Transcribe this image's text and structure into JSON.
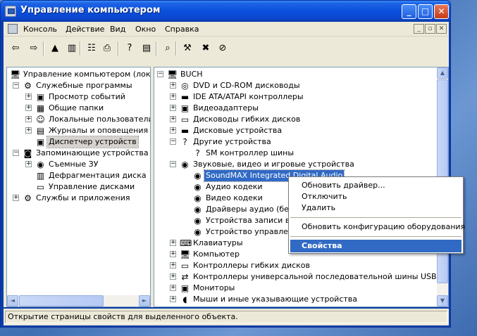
{
  "window": {
    "title": "Управление компьютером",
    "minimize_glyph": "_",
    "maximize_glyph": "□",
    "close_glyph": "✕"
  },
  "menubar": {
    "items": [
      "Консоль",
      "Действие",
      "Вид",
      "Окно",
      "Справка"
    ],
    "mdi_minimize": "_",
    "mdi_restore": "▫",
    "mdi_close": "✕"
  },
  "toolbar": {
    "tools": [
      {
        "icon": "back-arrow-icon",
        "glyph": "⇦"
      },
      {
        "icon": "forward-arrow-icon",
        "glyph": "⇨"
      },
      {
        "icon": "up-folder-icon",
        "glyph": "▲"
      },
      {
        "icon": "show-hide-tree-icon",
        "glyph": "▥"
      },
      {
        "icon": "properties-icon",
        "glyph": "☷"
      },
      {
        "icon": "print-icon",
        "glyph": "⎙"
      },
      {
        "icon": "help-icon",
        "glyph": "?"
      },
      {
        "icon": "show-hide-action-pane-icon",
        "glyph": "▤"
      },
      {
        "icon": "scan-hardware-icon",
        "glyph": "⌕"
      },
      {
        "icon": "update-driver-icon",
        "glyph": "⚒"
      },
      {
        "icon": "uninstall-device-icon",
        "glyph": "✖"
      },
      {
        "icon": "disable-device-icon",
        "glyph": "⊘"
      }
    ]
  },
  "left_tree": {
    "items": [
      {
        "label": "Управление компьютером (локаль",
        "icon": "computer-management-icon",
        "glyph": "🖥",
        "expander": "",
        "level": 0
      },
      {
        "label": "Служебные программы",
        "icon": "system-tools-icon",
        "glyph": "⚙",
        "expander": "−",
        "level": 1
      },
      {
        "label": "Просмотр событий",
        "icon": "event-viewer-icon",
        "glyph": "▣",
        "expander": "+",
        "level": 2
      },
      {
        "label": "Общие папки",
        "icon": "shared-folders-icon",
        "glyph": "▦",
        "expander": "+",
        "level": 2
      },
      {
        "label": "Локальные пользователи",
        "icon": "local-users-icon",
        "glyph": "☺",
        "expander": "+",
        "level": 2
      },
      {
        "label": "Журналы и оповещения пр",
        "icon": "performance-logs-icon",
        "glyph": "▤",
        "expander": "+",
        "level": 2
      },
      {
        "label": "Диспетчер устройств",
        "icon": "device-manager-icon",
        "glyph": "▣",
        "expander": "",
        "level": 2,
        "selected": true
      },
      {
        "label": "Запоминающие устройства",
        "icon": "storage-icon",
        "glyph": "◙",
        "expander": "−",
        "level": 1
      },
      {
        "label": "Съемные ЗУ",
        "icon": "removable-storage-icon",
        "glyph": "◉",
        "expander": "+",
        "level": 2
      },
      {
        "label": "Дефрагментация диска",
        "icon": "defragmenter-icon",
        "glyph": "▥",
        "expander": "",
        "level": 2
      },
      {
        "label": "Управление дисками",
        "icon": "disk-management-icon",
        "glyph": "▭",
        "expander": "",
        "level": 2
      },
      {
        "label": "Службы и приложения",
        "icon": "services-apps-icon",
        "glyph": "⚙",
        "expander": "+",
        "level": 1
      }
    ]
  },
  "right_tree": {
    "items": [
      {
        "label": "BUCH",
        "icon": "computer-icon",
        "glyph": "🖥",
        "expander": "−",
        "level": 0
      },
      {
        "label": "DVD и CD-ROM дисководы",
        "icon": "cdrom-icon",
        "glyph": "◎",
        "expander": "+",
        "level": 1
      },
      {
        "label": "IDE ATA/ATAPI контроллеры",
        "icon": "ide-controller-icon",
        "glyph": "▬",
        "expander": "+",
        "level": 1
      },
      {
        "label": "Видеоадаптеры",
        "icon": "display-adapter-icon",
        "glyph": "▣",
        "expander": "+",
        "level": 1
      },
      {
        "label": "Дисководы гибких дисков",
        "icon": "floppy-drive-icon",
        "glyph": "▭",
        "expander": "+",
        "level": 1
      },
      {
        "label": "Дисковые устройства",
        "icon": "disk-drive-icon",
        "glyph": "▬",
        "expander": "+",
        "level": 1
      },
      {
        "label": "Другие устройства",
        "icon": "unknown-device-icon",
        "glyph": "?",
        "expander": "−",
        "level": 1
      },
      {
        "label": "SM контроллер шины",
        "icon": "unknown-device-icon",
        "glyph": "?",
        "expander": "",
        "level": 2
      },
      {
        "label": "Звуковые, видео и игровые устройства",
        "icon": "sound-device-icon",
        "glyph": "◉",
        "expander": "−",
        "level": 1
      },
      {
        "label": "SoundMAX Integrated Digital Audio",
        "icon": "sound-device-icon",
        "glyph": "◉",
        "expander": "",
        "level": 2,
        "selected": true
      },
      {
        "label": "Аудио кодеки",
        "icon": "sound-device-icon",
        "glyph": "◉",
        "expander": "",
        "level": 2
      },
      {
        "label": "Видео кодеки",
        "icon": "sound-device-icon",
        "glyph": "◉",
        "expander": "",
        "level": 2
      },
      {
        "label": "Драйверы аудио (без P",
        "icon": "sound-device-icon",
        "glyph": "◉",
        "expander": "",
        "level": 2
      },
      {
        "label": "Устройства записи вид",
        "icon": "sound-device-icon",
        "glyph": "◉",
        "expander": "",
        "level": 2
      },
      {
        "label": "Устройство управлени",
        "icon": "sound-device-icon",
        "glyph": "◉",
        "expander": "",
        "level": 2
      },
      {
        "label": "Клавиатуры",
        "icon": "keyboard-icon",
        "glyph": "⌨",
        "expander": "+",
        "level": 1
      },
      {
        "label": "Компьютер",
        "icon": "computer-icon",
        "glyph": "🖥",
        "expander": "+",
        "level": 1
      },
      {
        "label": "Контроллеры гибких дисков",
        "icon": "floppy-controller-icon",
        "glyph": "▭",
        "expander": "+",
        "level": 1
      },
      {
        "label": "Контроллеры универсальной последовательной шины USB",
        "icon": "usb-controller-icon",
        "glyph": "⇄",
        "expander": "+",
        "level": 1
      },
      {
        "label": "Мониторы",
        "icon": "monitor-icon",
        "glyph": "▣",
        "expander": "+",
        "level": 1
      },
      {
        "label": "Мыши и иные указывающие устройства",
        "icon": "mouse-icon",
        "glyph": "◖",
        "expander": "+",
        "level": 1
      }
    ]
  },
  "context_menu": {
    "update_driver": "Обновить драйвер...",
    "disable": "Отключить",
    "uninstall": "Удалить",
    "scan_hardware": "Обновить конфигурацию оборудования",
    "properties": "Свойства"
  },
  "scroll": {
    "up": "▲",
    "down": "▼",
    "left": "◄",
    "right": "►"
  },
  "statusbar": {
    "text": "Открытие страницы свойств для выделенного объекта."
  }
}
